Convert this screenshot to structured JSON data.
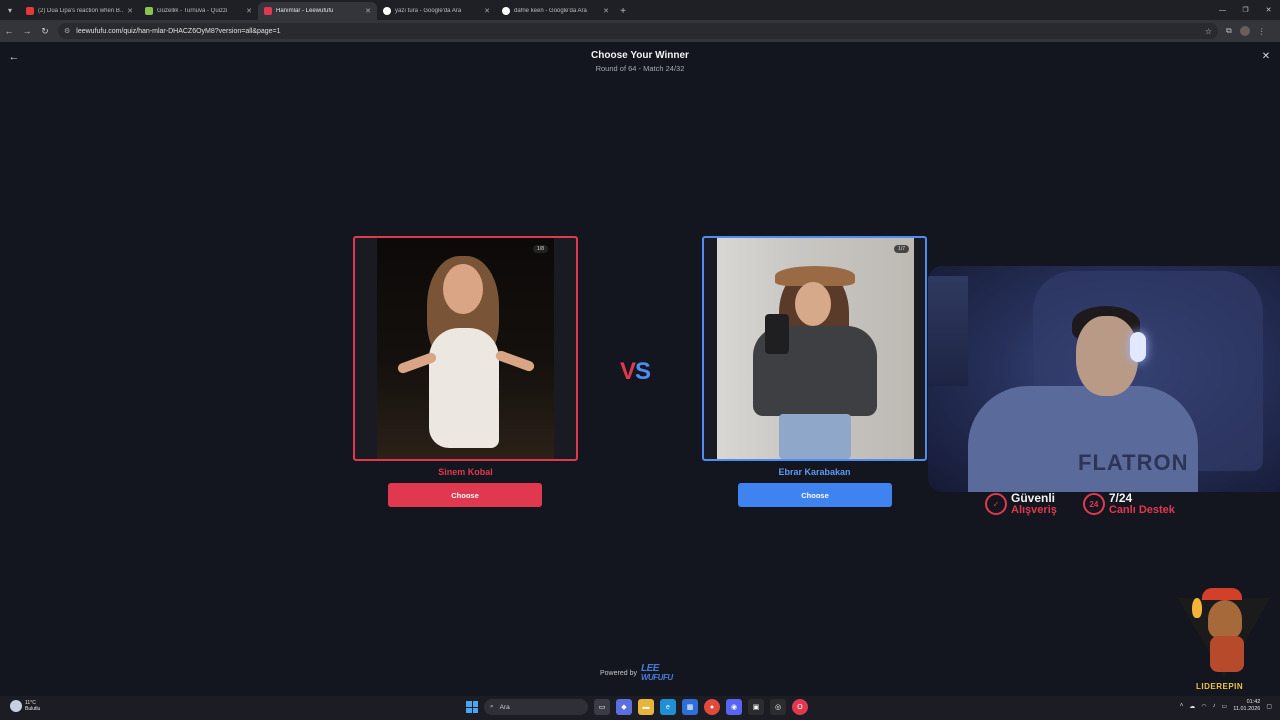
{
  "browser": {
    "tabs": [
      {
        "label": "(2) Dua Lipa's reaction when B...",
        "favicon_color": "#e53935",
        "active": false
      },
      {
        "label": "Güzellik - Turnuva - Quizzi",
        "favicon_color": "#8bc34a",
        "active": false
      },
      {
        "label": "Hanımlar - Leewufufu",
        "favicon_color": "#e0394f",
        "active": true
      },
      {
        "label": "yazı tura - Google'da Ara",
        "favicon_color": "#ffffff",
        "active": false
      },
      {
        "label": "dafne keen - Google'da Ara",
        "favicon_color": "#ffffff",
        "active": false
      }
    ],
    "url": "leewufufu.com/quiz/han-mlar-DHACZ6OyM8?version=all&page=1"
  },
  "quiz": {
    "title": "Choose Your Winner",
    "subtitle": "Round of 64 - Match 24/32",
    "vs_v": "V",
    "vs_s": "S",
    "left": {
      "name": "Sinem Kobal",
      "counter": "1/8",
      "button": "Choose",
      "accent": "#e0394f"
    },
    "right": {
      "name": "Ebrar Karabakan",
      "counter": "1/7",
      "button": "Choose",
      "accent": "#3f83f0"
    },
    "powered_by": "Powered by",
    "logo_top": "LEE",
    "logo_bottom": "WUFUFU"
  },
  "overlay": {
    "shirt_text": "FLATRON",
    "promo1_icon": "✓",
    "promo1_line1": "Güvenli",
    "promo1_line2": "Alışveriş",
    "promo2_icon": "24",
    "promo2_line1": "7/24",
    "promo2_line2": "Canlı Destek",
    "mascot_label": "LIDEREPIN"
  },
  "taskbar": {
    "temp": "11°C",
    "weather": "Bulutlu",
    "search_placeholder": "Ara",
    "time": "01:42",
    "date": "11.01.2026"
  }
}
